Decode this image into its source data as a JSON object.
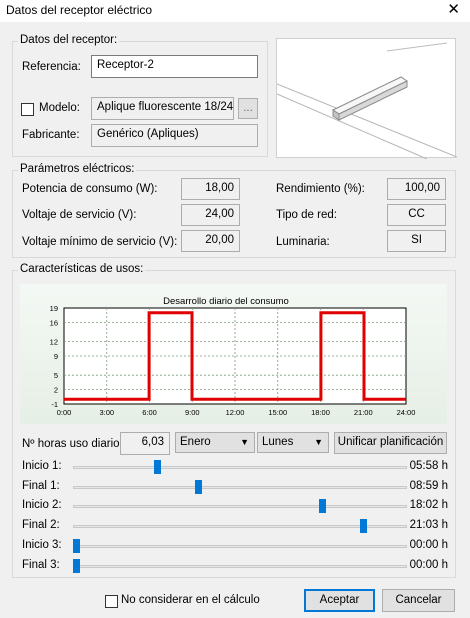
{
  "window": {
    "title": "Datos del receptor eléctrico",
    "close_glyph": "✕"
  },
  "receptor": {
    "group_title": "Datos del receptor:",
    "referencia_label": "Referencia:",
    "referencia_value": "Receptor-2",
    "modelo_label": "Modelo:",
    "modelo_checked": false,
    "modelo_value": "Aplique fluorescente 18/24",
    "browse_label": "...",
    "fabricante_label": "Fabricante:",
    "fabricante_value": "Genérico (Apliques)"
  },
  "electricos": {
    "group_title": "Parámetros eléctricos:",
    "potencia_label": "Potencia de consumo (W):",
    "potencia_value": "18,00",
    "voltaje_label": "Voltaje de servicio (V):",
    "voltaje_value": "24,00",
    "voltaje_min_label": "Voltaje mínimo de servicio (V):",
    "voltaje_min_value": "20,00",
    "rendimiento_label": "Rendimiento (%):",
    "rendimiento_value": "100,00",
    "tipo_red_label": "Tipo de red:",
    "tipo_red_value": "CC",
    "luminaria_label": "Luminaria:",
    "luminaria_value": "SI"
  },
  "usos": {
    "group_title": "Características de usos:",
    "horas_label": "Nº horas uso diario:",
    "horas_value": "6,03",
    "mes_value": "Enero",
    "dia_value": "Lunes",
    "unificar_label": "Unificar planificación",
    "sliders": [
      {
        "label": "Inicio 1:",
        "value": "05:58 h",
        "hours": 5.97
      },
      {
        "label": "Final 1:",
        "value": "08:59 h",
        "hours": 8.98
      },
      {
        "label": "Inicio 2:",
        "value": "18:02 h",
        "hours": 18.03
      },
      {
        "label": "Final 2:",
        "value": "21:03 h",
        "hours": 21.05
      },
      {
        "label": "Inicio 3:",
        "value": "00:00 h",
        "hours": 0
      },
      {
        "label": "Final 3:",
        "value": "00:00 h",
        "hours": 0
      }
    ]
  },
  "footer": {
    "no_considerar_label": "No considerar en el cálculo",
    "no_considerar_checked": false,
    "aceptar_label": "Aceptar",
    "cancelar_label": "Cancelar"
  },
  "colors": {
    "accent": "#0078d7",
    "series": "#e00000",
    "grid": "#7a9a7a"
  },
  "chart_data": {
    "type": "line",
    "title": "Desarrollo diario del consumo",
    "xlabel": "",
    "ylabel": "",
    "x_ticks": [
      "0:00",
      "3:00",
      "6:00",
      "9:00",
      "12:00",
      "15:00",
      "18:00",
      "21:00",
      "24:00"
    ],
    "y_ticks": [
      "19",
      "16",
      "12",
      "9",
      "5",
      "2",
      "-1"
    ],
    "xlim": [
      0,
      24
    ],
    "ylim": [
      -1,
      19
    ],
    "grid": true,
    "series": [
      {
        "x": [
          0,
          5.97,
          5.97,
          8.98,
          8.98,
          18.03,
          18.03,
          21.05,
          21.05,
          24
        ],
        "y": [
          0,
          0,
          18,
          18,
          0,
          0,
          18,
          18,
          0,
          0
        ]
      }
    ]
  }
}
